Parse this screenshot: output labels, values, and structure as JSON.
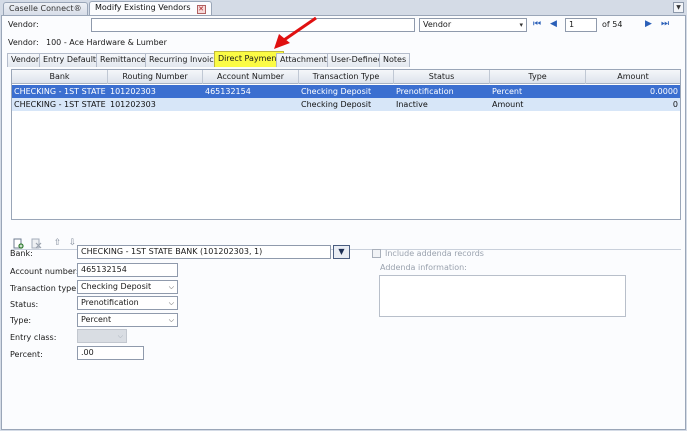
{
  "doc_tabs": [
    {
      "label": "Caselle Connect®",
      "active": false
    },
    {
      "label": "Modify Existing Vendors",
      "active": true
    }
  ],
  "header": {
    "vendor_label": "Vendor:",
    "search_value": "",
    "search_type": "Vendor",
    "record_number": "1",
    "record_total": "of 54",
    "vendor_info_label": "Vendor:",
    "vendor_info_value": "100  -  Ace Hardware & Lumber"
  },
  "subtabs": [
    "Vendor",
    "Entry Defaults",
    "Remittances",
    "Recurring Invoices",
    "Direct Payment",
    "Attachments",
    "User-Defined",
    "Notes"
  ],
  "grid": {
    "columns": [
      "Bank",
      "Routing Number",
      "Account Number",
      "Transaction Type",
      "Status",
      "Type",
      "Amount"
    ],
    "rows": [
      {
        "bank": "CHECKING - 1ST STATE ...",
        "routing": "101202303",
        "account": "465132154",
        "transaction_type": "Checking Deposit",
        "status": "Prenotification",
        "type": "Percent",
        "amount": "0.0000"
      },
      {
        "bank": "CHECKING - 1ST STATE ...",
        "routing": "101202303",
        "account": "",
        "transaction_type": "Checking Deposit",
        "status": "Inactive",
        "type": "Amount",
        "amount": "0"
      }
    ]
  },
  "form": {
    "bank_label": "Bank:",
    "bank_value": "CHECKING - 1ST STATE BANK (101202303, 1)",
    "account_label": "Account number:",
    "account_value": "465132154",
    "transaction_type_label": "Transaction type:",
    "transaction_type_value": "Checking Deposit",
    "status_label": "Status:",
    "status_value": "Prenotification",
    "type_label": "Type:",
    "type_value": "Percent",
    "entry_class_label": "Entry class:",
    "entry_class_value": "",
    "percent_label": "Percent:",
    "percent_value": ".00",
    "include_addenda_label": "Include addenda records",
    "addenda_info_label": "Addenda information:"
  },
  "colors": {
    "highlight_tab": "#fbfb45",
    "selected_row": "#3b6fd0",
    "alt_row": "#d7e6f8",
    "annotation_arrow": "#e01010"
  }
}
